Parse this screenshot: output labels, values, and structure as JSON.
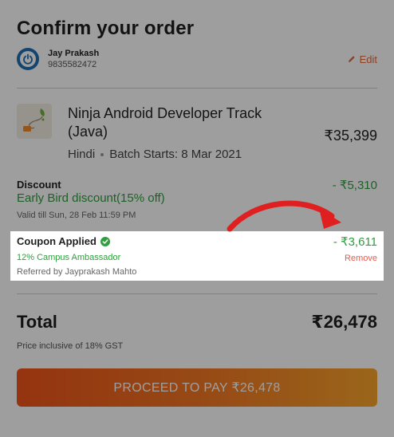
{
  "header": {
    "title": "Confirm your order"
  },
  "user": {
    "name": "Jay Prakash",
    "phone": "9835582472",
    "edit_label": "Edit"
  },
  "course": {
    "title": "Ninja Android Developer Track (Java)",
    "language": "Hindi",
    "batch": "Batch Starts: 8 Mar 2021",
    "price": "₹35,399"
  },
  "discount": {
    "label": "Discount",
    "name": "Early Bird discount(15% off)",
    "valid": "Valid till Sun, 28 Feb 11:59 PM",
    "amount": "- ₹5,310"
  },
  "coupon": {
    "label": "Coupon Applied",
    "code": "12% Campus Ambassador",
    "referred": "Referred by Jayprakash Mahto",
    "amount": "- ₹3,611",
    "remove_label": "Remove"
  },
  "total": {
    "label": "Total",
    "amount": "₹26,478",
    "gst_note": "Price inclusive of 18% GST"
  },
  "cta": {
    "label": "PROCEED TO PAY ₹26,478"
  },
  "colors": {
    "accent_green": "#2e9e3e",
    "accent_orange": "#e36a3c",
    "remove_red": "#e85a4f",
    "avatar_blue": "#1f6fb5",
    "annotation_arrow": "#e02020"
  },
  "icons": {
    "edit": "pencil-icon",
    "coupon_status": "check-circle-icon",
    "avatar": "power-icon",
    "annotation": "curved-arrow-icon"
  }
}
